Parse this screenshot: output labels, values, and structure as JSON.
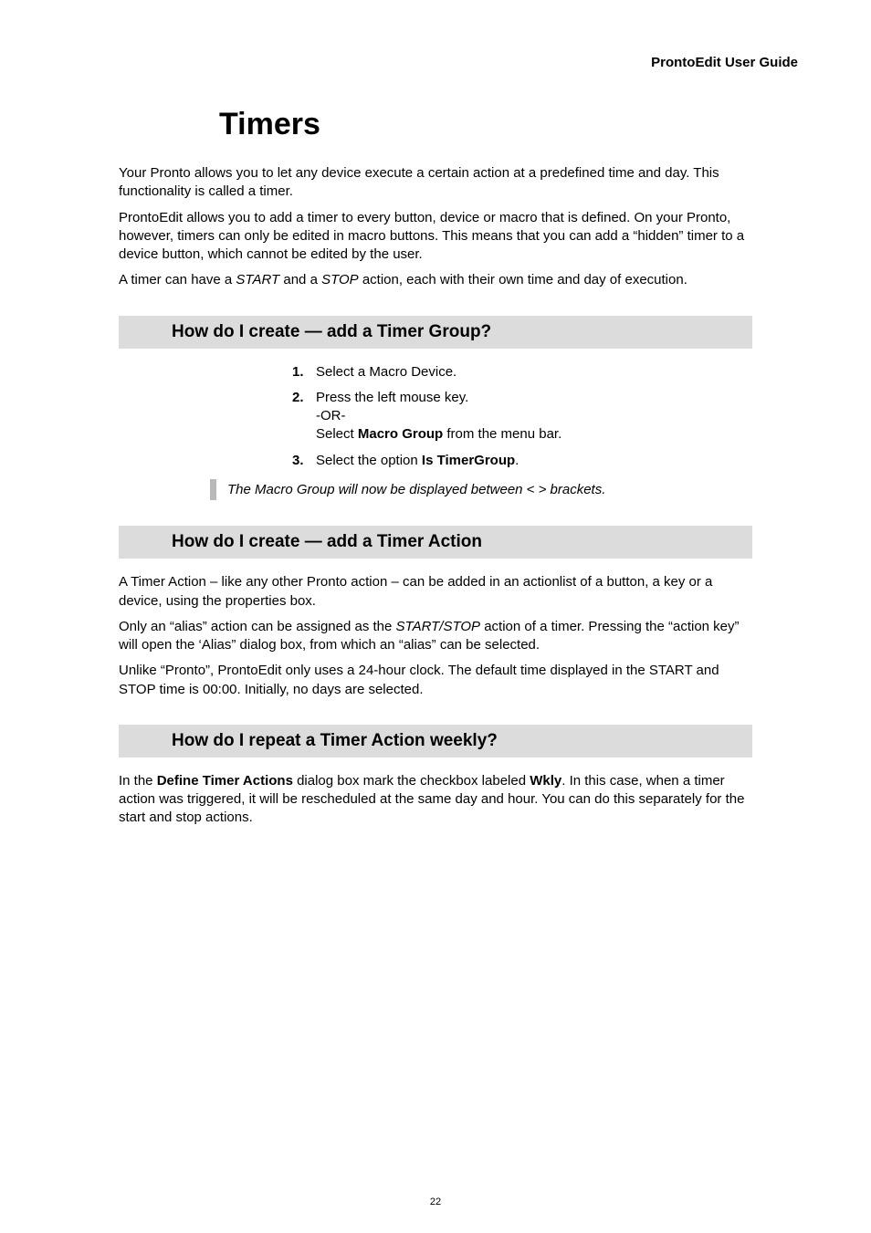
{
  "running_head": "ProntoEdit User Guide",
  "chapter_title": "Timers",
  "intro_p1_a": "Your Pronto allows you to let any device execute a certain action at a predefined time and day. This functionality is called a timer.",
  "intro_p2_a": "ProntoEdit allows you to add a timer to every button, device or macro that is defined. On your Pronto, however, timers can only be edited in macro buttons. This means that you can add a “hidden” timer to a device button, which cannot be edited by the user.",
  "intro_p3_pre": "A timer can have a ",
  "intro_p3_start": "START",
  "intro_p3_mid": " and a ",
  "intro_p3_stop": "STOP",
  "intro_p3_post": " action, each with their own time and day of execution.",
  "sec1_title": "How do I create — add a Timer Group?",
  "sec1_step1_num": "1.",
  "sec1_step1_body": "Select a Macro Device.",
  "sec1_step2_num": "2.",
  "sec1_step2_l1": "Press the left mouse key.",
  "sec1_step2_l2": "-OR-",
  "sec1_step2_l3_pre": "Select ",
  "sec1_step2_l3_b": "Macro Group",
  "sec1_step2_l3_post": " from the menu bar.",
  "sec1_step3_num": "3.",
  "sec1_step3_pre": "Select the option ",
  "sec1_step3_b": "Is TimerGroup",
  "sec1_step3_post": ".",
  "sec1_note": "The Macro Group will now be displayed between < > brackets.",
  "sec2_title": "How do I create — add a Timer Action",
  "sec2_p1": "A Timer Action – like any other Pronto action – can be added in an actionlist of a button, a key or a device, using the properties box.",
  "sec2_p2_pre": "Only an “alias” action can be assigned as the ",
  "sec2_p2_i": "START/STOP",
  "sec2_p2_post": " action of a timer. Pressing the “action key” will open the ‘Alias” dialog box, from which an “alias” can be selected.",
  "sec2_p3": "Unlike “Pronto”, ProntoEdit only uses a 24-hour clock. The default time displayed in the START and STOP time is 00:00. Initially, no days are selected.",
  "sec3_title": "How do I repeat a Timer Action weekly?",
  "sec3_p1_pre": "In the ",
  "sec3_p1_b1": "Define Timer Actions",
  "sec3_p1_mid": " dialog box mark the checkbox labeled ",
  "sec3_p1_b2": "Wkly",
  "sec3_p1_post": ". In this case, when a timer action was triggered, it will be rescheduled at the same day and hour. You can do this separately for the start and stop actions.",
  "page_number": "22"
}
